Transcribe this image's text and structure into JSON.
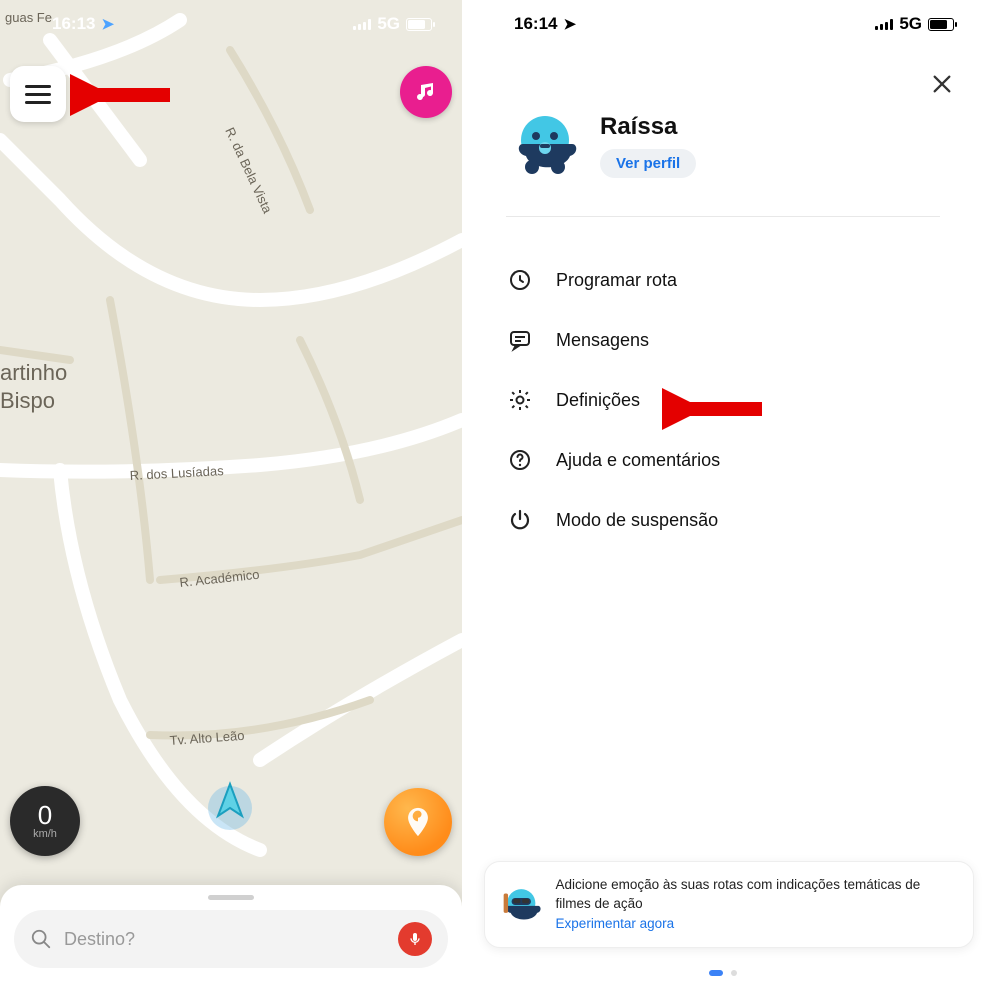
{
  "left": {
    "status": {
      "time": "16:13",
      "network": "5G"
    },
    "map_labels": {
      "guas": "guas Fe",
      "bela_vista": "R. da Bela Vista",
      "artinho": "artinho",
      "bispo": "Bispo",
      "lusiadas": "R. dos Lusíadas",
      "academico": "R. Académico",
      "alto_leao": "Tv. Alto Leão"
    },
    "speed": {
      "value": "0",
      "unit": "km/h"
    },
    "search": {
      "placeholder": "Destino?"
    }
  },
  "right": {
    "status": {
      "time": "16:14",
      "network": "5G"
    },
    "profile": {
      "name": "Raíssa",
      "view_profile": "Ver perfil"
    },
    "menu": {
      "schedule": "Programar rota",
      "messages": "Mensagens",
      "settings": "Definições",
      "help": "Ajuda e comentários",
      "sleep": "Modo de suspensão"
    },
    "promo": {
      "text": "Adicione emoção às suas rotas com indicações temáticas de filmes de ação",
      "link": "Experimentar agora"
    }
  }
}
